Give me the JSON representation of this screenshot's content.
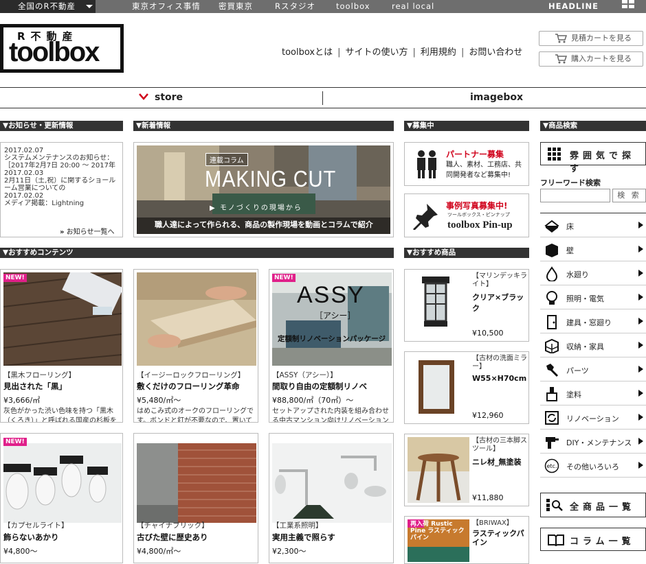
{
  "topbar": {
    "first": "全国のR不動産",
    "links": [
      "東京オフィス事情",
      "密買東京",
      "Rスタジオ",
      "toolbox",
      "real local"
    ],
    "headline": "HEADLINE"
  },
  "logo": {
    "line1": "R不動産",
    "line2": "toolbox"
  },
  "header_nav": [
    "toolboxとは",
    "サイトの使い方",
    "利用規約",
    "お問い合わせ"
  ],
  "nav_separator": "|",
  "carts": {
    "estimate": "見積カートを見る",
    "purchase": "購入カートを見る"
  },
  "tabs": {
    "store": "store",
    "imagebox": "imagebox"
  },
  "sections": {
    "news": "▼お知らせ・更新情報",
    "arrivals": "▼新着情報",
    "recruit": "▼募集中",
    "search": "▼商品検索",
    "recommend_contents": "▼おすすめコンテンツ",
    "recommend_products": "▼おすすめ商品"
  },
  "news": {
    "items": [
      {
        "date": "2017.02.07",
        "text": "システムメンテナンスのお知らせ：［2017年2月7日 20:00 〜 2017年2月"
      },
      {
        "date": "2017.02.03",
        "text": "2月11日（土,祝）に関するショールーム営業についての"
      },
      {
        "date": "2017.02.02",
        "text": "メディア掲載：Lightning"
      }
    ],
    "more": "お知らせ一覧へ",
    "more_icon": "»"
  },
  "arrival": {
    "badge": "連載コラム",
    "title": "MAKING CUT",
    "subtitle": "▶ モノづくりの現場から",
    "caption": "職人達によって作られる、商品の製作現場を動画とコラムで紹介"
  },
  "recruit": {
    "partner_title": "パートナー募集",
    "partner_text": "職人、素材、工務店、共同開発者など募集中!",
    "pinup_title": "事例写真募集中!",
    "pinup_sub": "ツールボックス・ピンナップ",
    "pinup_logo": "toolbox Pin-up"
  },
  "search": {
    "mood": "雰囲気で探す",
    "free_label": "フリーワード検索",
    "button": "検 索",
    "input_value": "",
    "categories": [
      "床",
      "壁",
      "水廻り",
      "照明・電気",
      "建具・窓廻り",
      "収納・家具",
      "パーツ",
      "塗料",
      "リノベーション",
      "DIY・メンテナンス",
      "その他いろいろ"
    ],
    "all": "全商品一覧",
    "column": "コラム一覧"
  },
  "contents": [
    {
      "new": "NEW!",
      "cat": "【黒木フローリング】",
      "title": "見出された「黒」",
      "price": "¥3,666/㎡",
      "desc": "灰色がかった渋い色味を持つ「黒木（くろき）」と呼ばれる国産の杉板を"
    },
    {
      "new": "",
      "cat": "【イージーロックフローリング】",
      "title": "敷くだけのフローリング革命",
      "price": "¥5,480/㎡〜",
      "desc": "はめこみ式のオークのフローリングです。ボンドと釘が不要なので、置いて"
    },
    {
      "new": "NEW!",
      "cat": "【ASSY（アシー）】",
      "title": "間取り自由の定額制リノベ",
      "price": "¥88,800/㎡（70㎡）〜",
      "desc": "セットアップされた内装を組み合わせる中古マンション向けリノベーション",
      "overlay": "ASSY",
      "overlay_sub": "［アシー］",
      "overlay_cap": "定額制リノベーションパッケージ"
    },
    {
      "new": "NEW!",
      "cat": "【カプセルライト】",
      "title": "飾らないあかり",
      "price": "¥4,800〜"
    },
    {
      "new": "",
      "cat": "【チャイナブリック】",
      "title": "古びた壁に歴史あり",
      "price": "¥4,800/㎡〜"
    },
    {
      "new": "",
      "cat": "【工業系照明】",
      "title": "実用主義で照らす",
      "price": "¥2,300〜"
    }
  ],
  "products": [
    {
      "cat": "【マリンデッキライト】",
      "name": "クリア×ブラック",
      "price": "¥10,500"
    },
    {
      "cat": "【古材の洗面ミラー】",
      "name": "W55×H70cm",
      "price": "¥12,960"
    },
    {
      "cat": "【古材の三本脚スツール】",
      "name": "ニレ材_無塗装",
      "price": "¥11,880"
    },
    {
      "cat": "【BRIWAX】",
      "name": "ラスティックパイン",
      "img_text": "再入荷 Rustic Pine ラスティック パイン"
    }
  ]
}
